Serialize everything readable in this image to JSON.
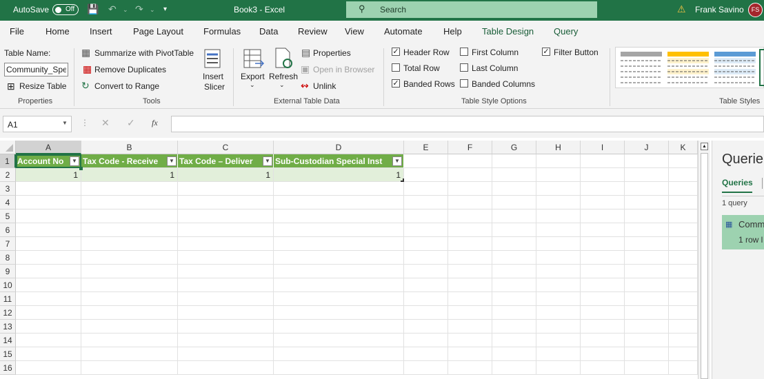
{
  "titlebar": {
    "autosave_label": "AutoSave",
    "autosave_state": "Off",
    "document_title": "Book3  -  Excel",
    "search_placeholder": "Search",
    "user_name": "Frank Savino",
    "user_initials": "FS"
  },
  "menu": [
    "File",
    "Home",
    "Insert",
    "Page Layout",
    "Formulas",
    "Data",
    "Review",
    "View",
    "Automate",
    "Help",
    "Table Design",
    "Query"
  ],
  "ribbon": {
    "table_name_label": "Table Name:",
    "table_name_value": "Community_Spe",
    "resize_table": "Resize Table",
    "properties_group": "Properties",
    "summarize": "Summarize with PivotTable",
    "remove_duplicates": "Remove Duplicates",
    "convert_range": "Convert to Range",
    "insert_slicer_1": "Insert",
    "insert_slicer_2": "Slicer",
    "tools_group": "Tools",
    "export": "Export",
    "refresh": "Refresh",
    "properties": "Properties",
    "open_browser": "Open in Browser",
    "unlink": "Unlink",
    "external_group": "External Table Data",
    "header_row": "Header Row",
    "total_row": "Total Row",
    "banded_rows": "Banded Rows",
    "first_column": "First Column",
    "last_column": "Last Column",
    "banded_columns": "Banded Columns",
    "filter_button": "Filter Button",
    "style_options_group": "Table Style Options",
    "styles_group": "Table Styles",
    "checks": {
      "header_row": true,
      "total_row": false,
      "banded_rows": true,
      "first_column": false,
      "last_column": false,
      "banded_columns": false,
      "filter_button": true
    }
  },
  "formula_bar": {
    "name_box": "A1",
    "fx": "fx",
    "value": ""
  },
  "sheet": {
    "columns": [
      "A",
      "B",
      "C",
      "D",
      "E",
      "F",
      "G",
      "H",
      "I",
      "J",
      "K"
    ],
    "rows": [
      "1",
      "2",
      "3",
      "4",
      "5",
      "6",
      "7",
      "8",
      "9",
      "10",
      "11",
      "12",
      "13",
      "14",
      "15",
      "16"
    ],
    "table_headers": [
      "Account No",
      "Tax Code - Receive",
      "Tax Code – Deliver",
      "Sub-Custodian Special Inst"
    ],
    "table_row": [
      "1",
      "1",
      "1",
      "1"
    ]
  },
  "queries_pane": {
    "title": "Querie",
    "tab": "Queries",
    "count": "1 query",
    "item_name": "Comm",
    "item_sub": "1 row l"
  },
  "colors": {
    "excel_green": "#217346",
    "table_header": "#70ad47",
    "table_band": "#e2efda"
  }
}
